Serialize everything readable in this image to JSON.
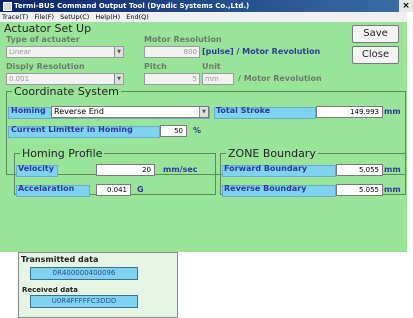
{
  "window": {
    "title": "Termi-BUS Command Output Tool (Dyadic Systems Co.,Ltd.)",
    "close_glyph": "×"
  },
  "menu": [
    "Trace(T)",
    "File(F)",
    "SetUp(C)",
    "Help(H)",
    "End(Q)"
  ],
  "actuator": {
    "heading": "Actuator Set Up",
    "type_label": "Type of actuater",
    "type_value": "Linear",
    "motor_res_label": "Motor Resolution",
    "motor_res_value": "800",
    "motor_res_unit": "[pulse] / Motor Revolution",
    "disp_res_label": "Disply Resolution",
    "disp_res_value": "0.001",
    "pitch_label": "Pitch",
    "pitch_value": "5",
    "unit_label": "Unit",
    "unit_value": "mm",
    "per_motor_rev": "/ Motor Revolution",
    "save_label": "Save",
    "close_label": "Close"
  },
  "coordinate": {
    "heading": "Coordinate System",
    "homing_label": "Homing",
    "homing_value": "Reverse End",
    "total_stroke_label": "Total Stroke",
    "total_stroke_value": "149.993",
    "total_stroke_unit": "mm",
    "current_limit_label": "Current Limitter in Homing",
    "current_limit_value": "50",
    "current_limit_unit": "%"
  },
  "homing_profile": {
    "heading": "Homing Profile",
    "velocity_label": "Velocity",
    "velocity_value": "20",
    "velocity_unit": "mm/sec",
    "accel_label": "Accelaration",
    "accel_value": "0.041",
    "accel_unit": "G"
  },
  "zone": {
    "heading": "ZONE Boundary",
    "forward_label": "Forward Boundary",
    "forward_value": "5.055",
    "reverse_label": "Reverse Boundary",
    "reverse_value": "5.055",
    "unit": "mm"
  },
  "status": {
    "transmitted_label": "Transmitted data",
    "transmitted_value": "0R400000400096",
    "received_label": "Received data",
    "received_value": "U0R4FFFFFC3DDD"
  },
  "colors": {
    "panel_bg": "#9ae49a",
    "highlight": "#7fd3f0",
    "label_blue": "#2b3a9a"
  }
}
